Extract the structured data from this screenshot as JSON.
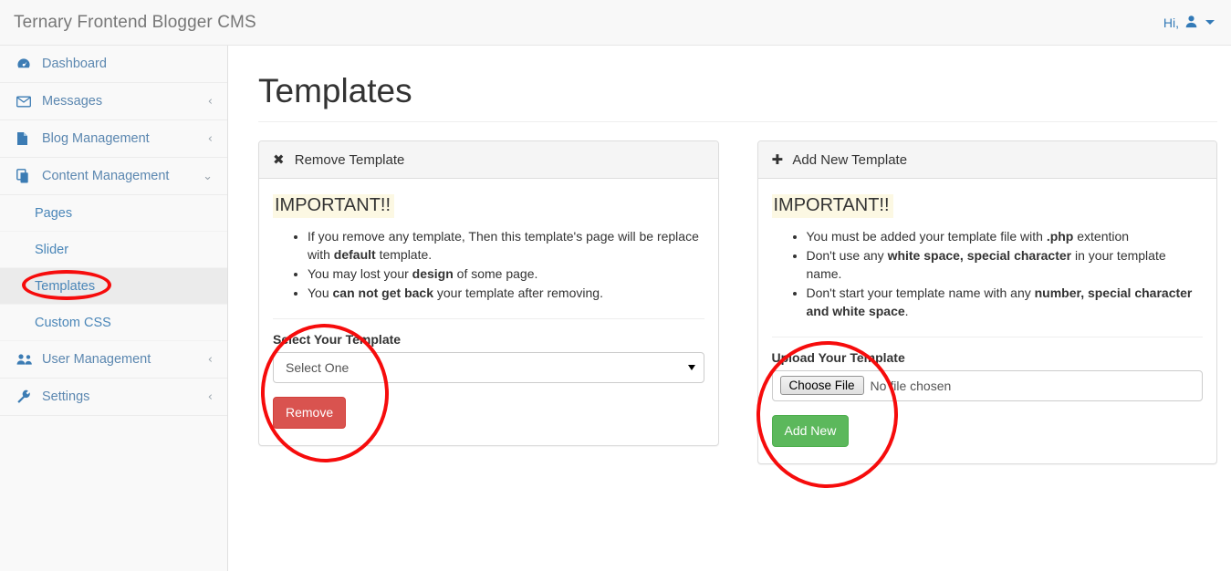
{
  "navbar": {
    "brand": "Ternary Frontend Blogger CMS",
    "greeting": "Hi,",
    "user_icon": "user-icon",
    "caret_icon": "caret-down-icon"
  },
  "sidebar": {
    "items": [
      {
        "label": "Dashboard",
        "icon": "dashboard-icon",
        "arrow": ""
      },
      {
        "label": "Messages",
        "icon": "envelope-icon",
        "arrow": "‹"
      },
      {
        "label": "Blog Management",
        "icon": "file-icon",
        "arrow": "‹"
      },
      {
        "label": "Content Management",
        "icon": "copy-icon",
        "arrow": "⌄"
      },
      {
        "label": "User Management",
        "icon": "users-icon",
        "arrow": "‹"
      },
      {
        "label": "Settings",
        "icon": "wrench-icon",
        "arrow": "‹"
      }
    ],
    "subitems": [
      {
        "label": "Pages",
        "active": false
      },
      {
        "label": "Slider",
        "active": false
      },
      {
        "label": "Templates",
        "active": true
      },
      {
        "label": "Custom CSS",
        "active": false
      }
    ]
  },
  "page": {
    "title": "Templates"
  },
  "remove_panel": {
    "heading": "Remove Template",
    "heading_icon": "close-x-icon",
    "important_label": "IMPORTANT!!",
    "notes": [
      {
        "parts": [
          {
            "t": "If you remove any template, Then this template's page will be replace with ",
            "b": false
          },
          {
            "t": "default",
            "b": true
          },
          {
            "t": " template.",
            "b": false
          }
        ]
      },
      {
        "parts": [
          {
            "t": "You may lost your ",
            "b": false
          },
          {
            "t": "design",
            "b": true
          },
          {
            "t": " of some page.",
            "b": false
          }
        ]
      },
      {
        "parts": [
          {
            "t": "You ",
            "b": false
          },
          {
            "t": "can not get back",
            "b": true
          },
          {
            "t": " your template after removing.",
            "b": false
          }
        ]
      }
    ],
    "select_label": "Select Your Template",
    "select_value": "Select One",
    "select_options": [
      "Select One"
    ],
    "button_label": "Remove",
    "button_color": "#d9534f"
  },
  "add_panel": {
    "heading": "Add New Template",
    "heading_icon": "plus-icon",
    "important_label": "IMPORTANT!!",
    "notes": [
      {
        "parts": [
          {
            "t": "You must be added your template file with ",
            "b": false
          },
          {
            "t": ".php",
            "b": true
          },
          {
            "t": " extention",
            "b": false
          }
        ]
      },
      {
        "parts": [
          {
            "t": "Don't use any ",
            "b": false
          },
          {
            "t": "white space, special character",
            "b": true
          },
          {
            "t": " in your template name.",
            "b": false
          }
        ]
      },
      {
        "parts": [
          {
            "t": "Don't start your template name with any ",
            "b": false
          },
          {
            "t": "number, special character and white space",
            "b": true
          },
          {
            "t": ".",
            "b": false
          }
        ]
      }
    ],
    "upload_label": "Upload Your Template",
    "file_button_label": "Choose File",
    "file_status": "No file chosen",
    "button_label": "Add New",
    "button_color": "#5cb85c"
  },
  "annotations": {
    "color": "#f60c0c",
    "circles": [
      {
        "name": "sidebar-templates-highlight"
      },
      {
        "name": "remove-form-highlight"
      },
      {
        "name": "add-form-highlight"
      }
    ]
  }
}
